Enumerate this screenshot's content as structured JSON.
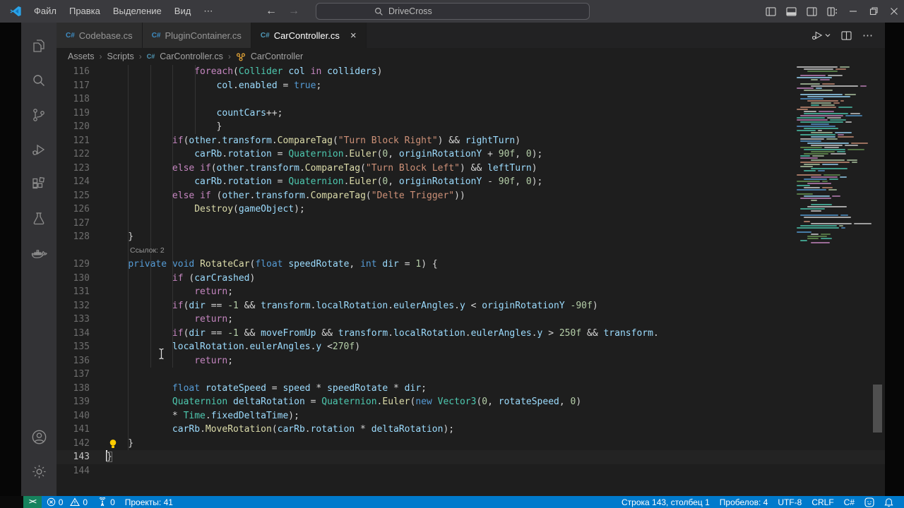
{
  "titlebar": {
    "menus": [
      "Файл",
      "Правка",
      "Выделение",
      "Вид",
      "⋯"
    ],
    "command_center": "DriveCross"
  },
  "tabs": [
    {
      "label": "Codebase.cs"
    },
    {
      "label": "PluginContainer.cs"
    },
    {
      "label": "CarController.cs",
      "active": true
    }
  ],
  "breadcrumb": {
    "items": [
      "Assets",
      "Scripts",
      "CarController.cs",
      "CarController"
    ]
  },
  "editor": {
    "token_colors": {
      "p": "#d4d4d4",
      "k": "#C586C0",
      "d": "#569CD6",
      "t": "#4EC9B0",
      "f": "#DCDCAA",
      "v": "#9CDCFE",
      "s": "#CE9178",
      "n": "#B5CEA8"
    },
    "lines": [
      {
        "n": 116,
        "t": [
          [
            "                ",
            "p"
          ],
          [
            "foreach",
            "k"
          ],
          [
            "(",
            "p"
          ],
          [
            "Collider",
            "t"
          ],
          [
            " ",
            "p"
          ],
          [
            "col",
            "v"
          ],
          [
            " ",
            "p"
          ],
          [
            "in",
            "k"
          ],
          [
            " ",
            "p"
          ],
          [
            "colliders",
            "v"
          ],
          [
            ")",
            "p"
          ]
        ]
      },
      {
        "n": 117,
        "t": [
          [
            "                    ",
            "p"
          ],
          [
            "col",
            "v"
          ],
          [
            ".",
            "p"
          ],
          [
            "enabled",
            "v"
          ],
          [
            " = ",
            "p"
          ],
          [
            "true",
            "d"
          ],
          [
            ";",
            "p"
          ]
        ]
      },
      {
        "n": 118,
        "t": []
      },
      {
        "n": 119,
        "t": [
          [
            "                    ",
            "p"
          ],
          [
            "countCars",
            "v"
          ],
          [
            "++;",
            "p"
          ]
        ]
      },
      {
        "n": 120,
        "t": [
          [
            "                    }",
            "p"
          ]
        ]
      },
      {
        "n": 121,
        "t": [
          [
            "            ",
            "p"
          ],
          [
            "if",
            "k"
          ],
          [
            "(",
            "p"
          ],
          [
            "other",
            "v"
          ],
          [
            ".",
            "p"
          ],
          [
            "transform",
            "v"
          ],
          [
            ".",
            "p"
          ],
          [
            "CompareTag",
            "f"
          ],
          [
            "(",
            "p"
          ],
          [
            "\"Turn Block Right\"",
            "s"
          ],
          [
            ") && ",
            "p"
          ],
          [
            "rightTurn",
            "v"
          ],
          [
            ")",
            "p"
          ]
        ]
      },
      {
        "n": 122,
        "t": [
          [
            "                ",
            "p"
          ],
          [
            "carRb",
            "v"
          ],
          [
            ".",
            "p"
          ],
          [
            "rotation",
            "v"
          ],
          [
            " = ",
            "p"
          ],
          [
            "Quaternion",
            "t"
          ],
          [
            ".",
            "p"
          ],
          [
            "Euler",
            "f"
          ],
          [
            "(",
            "p"
          ],
          [
            "0",
            "n"
          ],
          [
            ", ",
            "p"
          ],
          [
            "originRotationY",
            "v"
          ],
          [
            " + ",
            "p"
          ],
          [
            "90f",
            "n"
          ],
          [
            ", ",
            "p"
          ],
          [
            "0",
            "n"
          ],
          [
            ");",
            "p"
          ]
        ]
      },
      {
        "n": 123,
        "t": [
          [
            "            ",
            "p"
          ],
          [
            "else",
            "k"
          ],
          [
            " ",
            "p"
          ],
          [
            "if",
            "k"
          ],
          [
            "(",
            "p"
          ],
          [
            "other",
            "v"
          ],
          [
            ".",
            "p"
          ],
          [
            "transform",
            "v"
          ],
          [
            ".",
            "p"
          ],
          [
            "CompareTag",
            "f"
          ],
          [
            "(",
            "p"
          ],
          [
            "\"Turn Block Left\"",
            "s"
          ],
          [
            ") && ",
            "p"
          ],
          [
            "leftTurn",
            "v"
          ],
          [
            ")",
            "p"
          ]
        ]
      },
      {
        "n": 124,
        "t": [
          [
            "                ",
            "p"
          ],
          [
            "carRb",
            "v"
          ],
          [
            ".",
            "p"
          ],
          [
            "rotation",
            "v"
          ],
          [
            " = ",
            "p"
          ],
          [
            "Quaternion",
            "t"
          ],
          [
            ".",
            "p"
          ],
          [
            "Euler",
            "f"
          ],
          [
            "(",
            "p"
          ],
          [
            "0",
            "n"
          ],
          [
            ", ",
            "p"
          ],
          [
            "originRotationY",
            "v"
          ],
          [
            " - ",
            "p"
          ],
          [
            "90f",
            "n"
          ],
          [
            ", ",
            "p"
          ],
          [
            "0",
            "n"
          ],
          [
            ");",
            "p"
          ]
        ]
      },
      {
        "n": 125,
        "t": [
          [
            "            ",
            "p"
          ],
          [
            "else",
            "k"
          ],
          [
            " ",
            "p"
          ],
          [
            "if",
            "k"
          ],
          [
            " (",
            "p"
          ],
          [
            "other",
            "v"
          ],
          [
            ".",
            "p"
          ],
          [
            "transform",
            "v"
          ],
          [
            ".",
            "p"
          ],
          [
            "CompareTag",
            "f"
          ],
          [
            "(",
            "p"
          ],
          [
            "\"Delte Trigger\"",
            "s"
          ],
          [
            "))",
            "p"
          ]
        ]
      },
      {
        "n": 126,
        "t": [
          [
            "                ",
            "p"
          ],
          [
            "Destroy",
            "f"
          ],
          [
            "(",
            "p"
          ],
          [
            "gameObject",
            "v"
          ],
          [
            ");",
            "p"
          ]
        ]
      },
      {
        "n": 127,
        "t": []
      },
      {
        "n": 128,
        "t": [
          [
            "    }",
            "p"
          ]
        ]
      },
      {
        "n": 129,
        "lens": "Ссылок: 2",
        "t": [
          [
            "    ",
            "p"
          ],
          [
            "private",
            "d"
          ],
          [
            " ",
            "p"
          ],
          [
            "void",
            "d"
          ],
          [
            " ",
            "p"
          ],
          [
            "RotateCar",
            "f"
          ],
          [
            "(",
            "p"
          ],
          [
            "float",
            "d"
          ],
          [
            " ",
            "p"
          ],
          [
            "speedRotate",
            "v"
          ],
          [
            ", ",
            "p"
          ],
          [
            "int",
            "d"
          ],
          [
            " ",
            "p"
          ],
          [
            "dir",
            "v"
          ],
          [
            " = ",
            "p"
          ],
          [
            "1",
            "n"
          ],
          [
            ") {",
            "p"
          ]
        ]
      },
      {
        "n": 130,
        "t": [
          [
            "            ",
            "p"
          ],
          [
            "if",
            "k"
          ],
          [
            " (",
            "p"
          ],
          [
            "carCrashed",
            "v"
          ],
          [
            ")",
            "p"
          ]
        ]
      },
      {
        "n": 131,
        "t": [
          [
            "                ",
            "p"
          ],
          [
            "return",
            "k"
          ],
          [
            ";",
            "p"
          ]
        ]
      },
      {
        "n": 132,
        "t": [
          [
            "            ",
            "p"
          ],
          [
            "if",
            "k"
          ],
          [
            "(",
            "p"
          ],
          [
            "dir",
            "v"
          ],
          [
            " == ",
            "p"
          ],
          [
            "-1",
            "n"
          ],
          [
            " && ",
            "p"
          ],
          [
            "transform",
            "v"
          ],
          [
            ".",
            "p"
          ],
          [
            "localRotation",
            "v"
          ],
          [
            ".",
            "p"
          ],
          [
            "eulerAngles",
            "v"
          ],
          [
            ".",
            "p"
          ],
          [
            "y",
            "v"
          ],
          [
            " < ",
            "p"
          ],
          [
            "originRotationY",
            "v"
          ],
          [
            " ",
            "p"
          ],
          [
            "-90f",
            "n"
          ],
          [
            ")",
            "p"
          ]
        ]
      },
      {
        "n": 133,
        "t": [
          [
            "                ",
            "p"
          ],
          [
            "return",
            "k"
          ],
          [
            ";",
            "p"
          ]
        ]
      },
      {
        "n": 134,
        "t": [
          [
            "            ",
            "p"
          ],
          [
            "if",
            "k"
          ],
          [
            "(",
            "p"
          ],
          [
            "dir",
            "v"
          ],
          [
            " == ",
            "p"
          ],
          [
            "-1",
            "n"
          ],
          [
            " && ",
            "p"
          ],
          [
            "moveFromUp",
            "v"
          ],
          [
            " && ",
            "p"
          ],
          [
            "transform",
            "v"
          ],
          [
            ".",
            "p"
          ],
          [
            "localRotation",
            "v"
          ],
          [
            ".",
            "p"
          ],
          [
            "eulerAngles",
            "v"
          ],
          [
            ".",
            "p"
          ],
          [
            "y",
            "v"
          ],
          [
            " > ",
            "p"
          ],
          [
            "250f",
            "n"
          ],
          [
            " && ",
            "p"
          ],
          [
            "transform",
            "v"
          ],
          [
            ".",
            "p"
          ]
        ]
      },
      {
        "n": 135,
        "t": [
          [
            "            ",
            "p"
          ],
          [
            "localRotation",
            "v"
          ],
          [
            ".",
            "p"
          ],
          [
            "eulerAngles",
            "v"
          ],
          [
            ".",
            "p"
          ],
          [
            "y",
            "v"
          ],
          [
            " <",
            "p"
          ],
          [
            "270f",
            "n"
          ],
          [
            ")",
            "p"
          ]
        ]
      },
      {
        "n": 136,
        "t": [
          [
            "                ",
            "p"
          ],
          [
            "return",
            "k"
          ],
          [
            ";",
            "p"
          ]
        ]
      },
      {
        "n": 137,
        "t": []
      },
      {
        "n": 138,
        "t": [
          [
            "            ",
            "p"
          ],
          [
            "float",
            "d"
          ],
          [
            " ",
            "p"
          ],
          [
            "rotateSpeed",
            "v"
          ],
          [
            " = ",
            "p"
          ],
          [
            "speed",
            "v"
          ],
          [
            " * ",
            "p"
          ],
          [
            "speedRotate",
            "v"
          ],
          [
            " * ",
            "p"
          ],
          [
            "dir",
            "v"
          ],
          [
            ";",
            "p"
          ]
        ]
      },
      {
        "n": 139,
        "t": [
          [
            "            ",
            "p"
          ],
          [
            "Quaternion",
            "t"
          ],
          [
            " ",
            "p"
          ],
          [
            "deltaRotation",
            "v"
          ],
          [
            " = ",
            "p"
          ],
          [
            "Quaternion",
            "t"
          ],
          [
            ".",
            "p"
          ],
          [
            "Euler",
            "f"
          ],
          [
            "(",
            "p"
          ],
          [
            "new",
            "d"
          ],
          [
            " ",
            "p"
          ],
          [
            "Vector3",
            "t"
          ],
          [
            "(",
            "p"
          ],
          [
            "0",
            "n"
          ],
          [
            ", ",
            "p"
          ],
          [
            "rotateSpeed",
            "v"
          ],
          [
            ", ",
            "p"
          ],
          [
            "0",
            "n"
          ],
          [
            ")",
            "p"
          ]
        ]
      },
      {
        "n": 140,
        "t": [
          [
            "            * ",
            "p"
          ],
          [
            "Time",
            "t"
          ],
          [
            ".",
            "p"
          ],
          [
            "fixedDeltaTime",
            "v"
          ],
          [
            ");",
            "p"
          ]
        ]
      },
      {
        "n": 141,
        "t": [
          [
            "            ",
            "p"
          ],
          [
            "carRb",
            "v"
          ],
          [
            ".",
            "p"
          ],
          [
            "MoveRotation",
            "f"
          ],
          [
            "(",
            "p"
          ],
          [
            "carRb",
            "v"
          ],
          [
            ".",
            "p"
          ],
          [
            "rotation",
            "v"
          ],
          [
            " * ",
            "p"
          ],
          [
            "deltaRotation",
            "v"
          ],
          [
            ");",
            "p"
          ]
        ]
      },
      {
        "n": 142,
        "bulb": true,
        "t": [
          [
            "    }",
            "p"
          ]
        ]
      },
      {
        "n": 143,
        "cur": true,
        "t": [
          [
            "}",
            "p"
          ]
        ]
      },
      {
        "n": 144,
        "t": []
      }
    ]
  },
  "minimap": {
    "palette": [
      "#4EC9B0",
      "#9CDCFE",
      "#C586C0",
      "#CE9178",
      "#B5CEA8",
      "#d4d4d4",
      "#569CD6",
      "#6A9955"
    ]
  },
  "statusbar": {
    "errors": "0",
    "warnings": "0",
    "ports": "0",
    "projects": "Проекты: 41",
    "line_col": "Строка 143, столбец 1",
    "spaces": "Пробелов: 4",
    "encoding": "UTF-8",
    "eol": "CRLF",
    "language": "C#"
  },
  "colors": {
    "accent": "#007ACC",
    "remote_green": "#16825D",
    "editor_bg": "#1e1e1e",
    "titlebar_bg": "#3a3a3e"
  }
}
